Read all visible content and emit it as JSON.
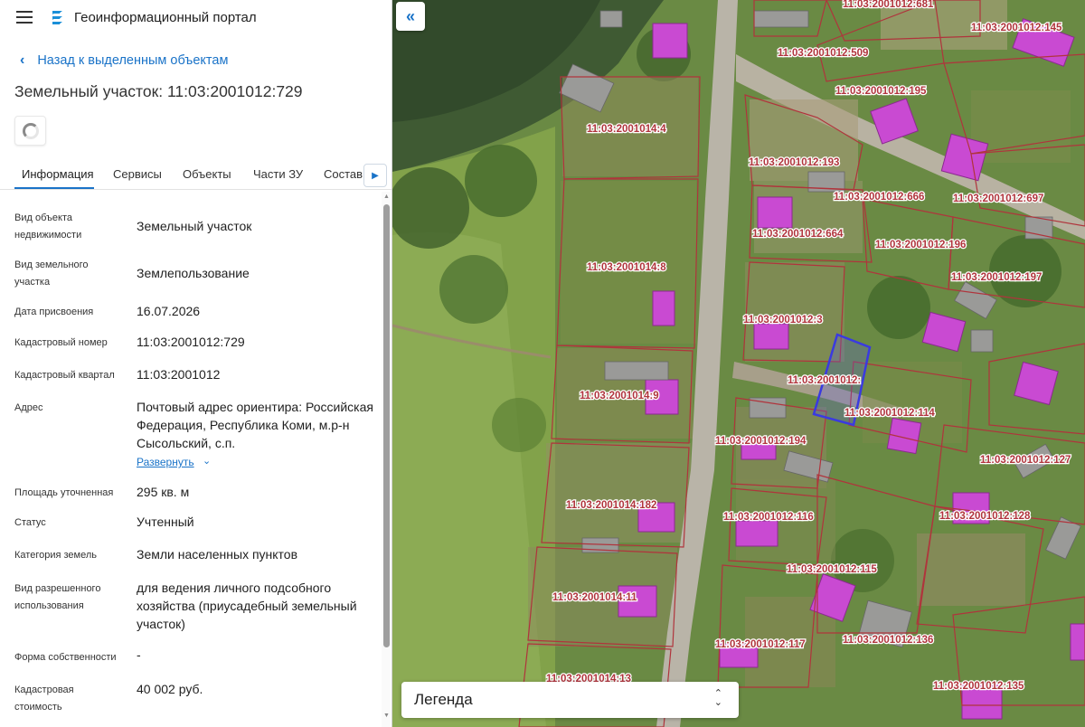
{
  "header": {
    "menu_icon": "hamburger-icon",
    "logo_icon": "portal-logo-icon",
    "title": "Геоинформационный портал"
  },
  "nav": {
    "back_label": "Назад к выделенным объектам"
  },
  "object": {
    "title": "Земельный участок: 11:03:2001012:729"
  },
  "tabs": [
    {
      "label": "Информация",
      "active": true
    },
    {
      "label": "Сервисы"
    },
    {
      "label": "Объекты"
    },
    {
      "label": "Части ЗУ"
    },
    {
      "label": "Состав"
    }
  ],
  "properties": [
    {
      "label": "Вид объекта недвижимости",
      "value": "Земельный участок"
    },
    {
      "label": "Вид земельного участка",
      "value": "Землепользование"
    },
    {
      "label": "Дата присвоения",
      "value": "16.07.2026"
    },
    {
      "label": "Кадастровый номер",
      "value": "11:03:2001012:729"
    },
    {
      "label": "Кадастровый квартал",
      "value": "11:03:2001012"
    },
    {
      "label": "Адрес",
      "value": "Почтовый адрес ориентира: Российская Федерация, Республика Коми, м.р-н Сысольский, с.п.",
      "expand_label": "Развернуть"
    },
    {
      "label": "Площадь уточненная",
      "value": "295 кв. м"
    },
    {
      "label": "Статус",
      "value": "Учтенный"
    },
    {
      "label": "Категория земель",
      "value": "Земли населенных пунктов"
    },
    {
      "label": "Вид разрешенного использования",
      "value": "для ведения личного подсобного хозяйства (приусадебный земельный участок)"
    },
    {
      "label": "Форма собственности",
      "value": "-"
    },
    {
      "label": "Кадастровая стоимость",
      "value": "40 002 руб."
    }
  ],
  "map": {
    "legend_label": "Легенда",
    "parcel_labels": [
      "11:03:2001012:681",
      "11:03:2001012:145",
      "11:03:2001012:509",
      "11:03:2001012:195",
      "11:03:2001014:4",
      "11:03:2001012:193",
      "11:03:2001012:666",
      "11:03:2001012:697",
      "11:03:2001012:664",
      "11:03:2001012:196",
      "11:03:2001014:8",
      "11:03:2001012:197",
      "11:03:2001012:3",
      "11:03:2001012:",
      "11:03:2001014:9",
      "11:03:2001012:114",
      "11:03:2001012:194",
      "11:03:2001012:127",
      "11:03:2001014:182",
      "11:03:2001012:116",
      "11:03:2001012:128",
      "11:03:2001012:115",
      "11:03:2001014:11",
      "11:03:2001012:117",
      "11:03:2001012:136",
      "11:03:2001014:13",
      "11:03:2001012:135"
    ],
    "colors": {
      "parcel_border": "#b0343c",
      "selected_parcel": "#3a3ae0",
      "building": "#c040c8",
      "accent": "#1a73c8"
    }
  }
}
